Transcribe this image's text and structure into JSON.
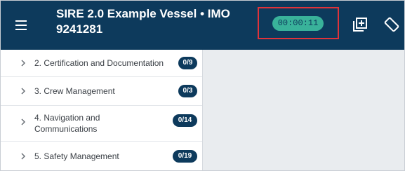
{
  "header": {
    "title": "SIRE 2.0 Example Vessel • IMO 9241281",
    "timer": "00:00:11",
    "icons": [
      "menu-icon",
      "add-box-icon",
      "rotate-screen-icon"
    ]
  },
  "sidebar": {
    "items": [
      {
        "label": "2. Certification and Documentation",
        "badge": "0/9"
      },
      {
        "label": "3. Crew Management",
        "badge": "0/3"
      },
      {
        "label": "4. Navigation and Communications",
        "badge": "0/14"
      },
      {
        "label": "5. Safety Management",
        "badge": "0/19"
      }
    ]
  },
  "colors": {
    "header_bg": "#0d3a5c",
    "timer_pill": "#39b29a",
    "highlight_border": "#e0333a",
    "badge_bg": "#0d3a5c",
    "content_bg": "#e9ecef"
  }
}
